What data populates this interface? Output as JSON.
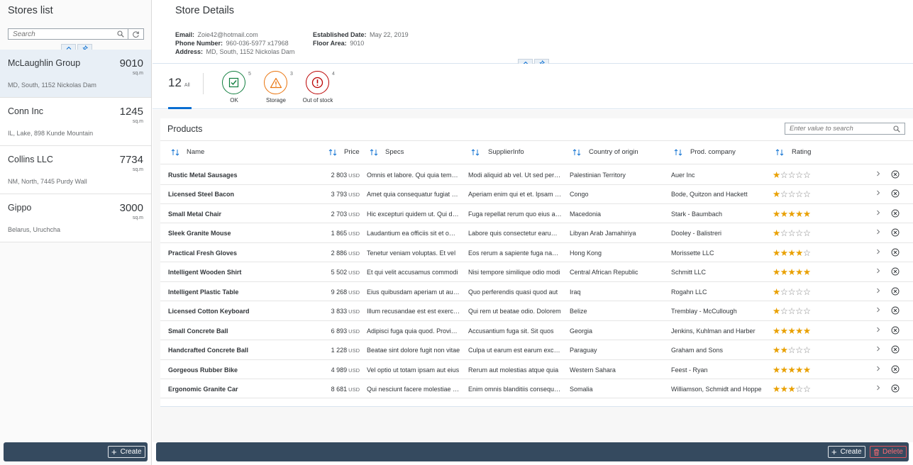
{
  "stores_panel": {
    "title": "Stores list",
    "search_placeholder": "Search",
    "stores": [
      {
        "name": "McLaughlin Group",
        "area": "9010",
        "unit": "sq.m",
        "address": "MD, South, 1152 Nickolas Dam"
      },
      {
        "name": "Conn Inc",
        "area": "1245",
        "unit": "sq.m",
        "address": "IL, Lake, 898 Kunde Mountain"
      },
      {
        "name": "Collins LLC",
        "area": "7734",
        "unit": "sq.m",
        "address": "NM, North, 7445 Purdy Wall"
      },
      {
        "name": "Gippo",
        "area": "3000",
        "unit": "sq.m",
        "address": "Belarus, Uruchcha"
      }
    ],
    "create_label": "Create"
  },
  "details": {
    "title": "Store Details",
    "email_label": "Email:",
    "email": "Zoie42@hotmail.com",
    "phone_label": "Phone Number:",
    "phone": "960-036-5977 x17968",
    "address_label": "Address:",
    "address": "MD, South, 1152 Nickolas Dam",
    "established_label": "Established Date:",
    "established": "May 22, 2019",
    "floor_label": "Floor Area:",
    "floor": "9010"
  },
  "icon_tabs": {
    "all_count": "12",
    "all_label": "All",
    "tabs": [
      {
        "label": "OK",
        "count": "5",
        "color": "#107e3e",
        "icon": "check-icon"
      },
      {
        "label": "Storage",
        "count": "3",
        "color": "#e9730c",
        "icon": "warning-icon"
      },
      {
        "label": "Out of stock",
        "count": "4",
        "color": "#bb0000",
        "icon": "error-icon"
      }
    ]
  },
  "products": {
    "title": "Products",
    "search_placeholder": "Enter value to search",
    "columns": {
      "name": "Name",
      "price": "Price",
      "specs": "Specs",
      "supplier": "SupplierInfo",
      "country": "Country of origin",
      "company": "Prod. company",
      "rating": "Rating"
    },
    "rating_color": "#e9a000",
    "rows": [
      {
        "name": "Rustic Metal Sausages",
        "price": "2 803",
        "currency": "USD",
        "specs": "Omnis et labore. Qui quia tempore",
        "supplier": "Modi aliquid ab vel. Ut sed perferendis",
        "country": "Palestinian Territory",
        "company": "Auer Inc",
        "rating": 1
      },
      {
        "name": "Licensed Steel Bacon",
        "price": "3 793",
        "currency": "USD",
        "specs": "Amet quia consequatur fugiat eos",
        "supplier": "Aperiam enim qui et et. Ipsam sed",
        "country": "Congo",
        "company": "Bode, Quitzon and Hackett",
        "rating": 1
      },
      {
        "name": "Small Metal Chair",
        "price": "2 703",
        "currency": "USD",
        "specs": "Hic excepturi quidem ut. Qui dolorum",
        "supplier": "Fuga repellat rerum quo eius autem",
        "country": "Macedonia",
        "company": "Stark - Baumbach",
        "rating": 5
      },
      {
        "name": "Sleek Granite Mouse",
        "price": "1 865",
        "currency": "USD",
        "specs": "Laudantium ea officiis sit et omnis",
        "supplier": "Labore quis consectetur earum nam",
        "country": "Libyan Arab Jamahiriya",
        "company": "Dooley - Balistreri",
        "rating": 1
      },
      {
        "name": "Practical Fresh Gloves",
        "price": "2 886",
        "currency": "USD",
        "specs": "Tenetur veniam voluptas. Et vel",
        "supplier": "Eos rerum a sapiente fuga nam quis",
        "country": "Hong Kong",
        "company": "Morissette LLC",
        "rating": 4
      },
      {
        "name": "Intelligent Wooden Shirt",
        "price": "5 502",
        "currency": "USD",
        "specs": "Et qui velit accusamus commodi",
        "supplier": "Nisi tempore similique odio modi",
        "country": "Central African Republic",
        "company": "Schmitt LLC",
        "rating": 5
      },
      {
        "name": "Intelligent Plastic Table",
        "price": "9 268",
        "currency": "USD",
        "specs": "Eius quibusdam aperiam ut autem",
        "supplier": "Quo perferendis quasi quod aut",
        "country": "Iraq",
        "company": "Rogahn LLC",
        "rating": 1
      },
      {
        "name": "Licensed Cotton Keyboard",
        "price": "3 833",
        "currency": "USD",
        "specs": "Illum recusandae est est exercitationem",
        "supplier": "Qui rem ut beatae odio. Dolorem",
        "country": "Belize",
        "company": "Tremblay - McCullough",
        "rating": 1
      },
      {
        "name": "Small Concrete Ball",
        "price": "6 893",
        "currency": "USD",
        "specs": "Adipisci fuga quia quod. Provident",
        "supplier": "Accusantium fuga sit. Sit quos",
        "country": "Georgia",
        "company": "Jenkins, Kuhlman and Harber",
        "rating": 5
      },
      {
        "name": "Handcrafted Concrete Ball",
        "price": "1 228",
        "currency": "USD",
        "specs": "Beatae sint dolore fugit non vitae",
        "supplier": "Culpa ut earum est earum excepturi",
        "country": "Paraguay",
        "company": "Graham and Sons",
        "rating": 2
      },
      {
        "name": "Gorgeous Rubber Bike",
        "price": "4 989",
        "currency": "USD",
        "specs": "Vel optio ut totam ipsam aut eius",
        "supplier": "Rerum aut molestias atque quia",
        "country": "Western Sahara",
        "company": "Feest - Ryan",
        "rating": 5
      },
      {
        "name": "Ergonomic Granite Car",
        "price": "8 681",
        "currency": "USD",
        "specs": "Qui nesciunt facere molestiae quo",
        "supplier": "Enim omnis blanditiis consequatur",
        "country": "Somalia",
        "company": "Williamson, Schmidt and Hoppe",
        "rating": 3
      }
    ]
  },
  "footer": {
    "create_label": "Create",
    "delete_label": "Delete"
  },
  "colors": {
    "accent": "#0a6ed1",
    "shell": "#354a5f",
    "selected": "#e8eff6",
    "delete": "#ff6c73"
  }
}
